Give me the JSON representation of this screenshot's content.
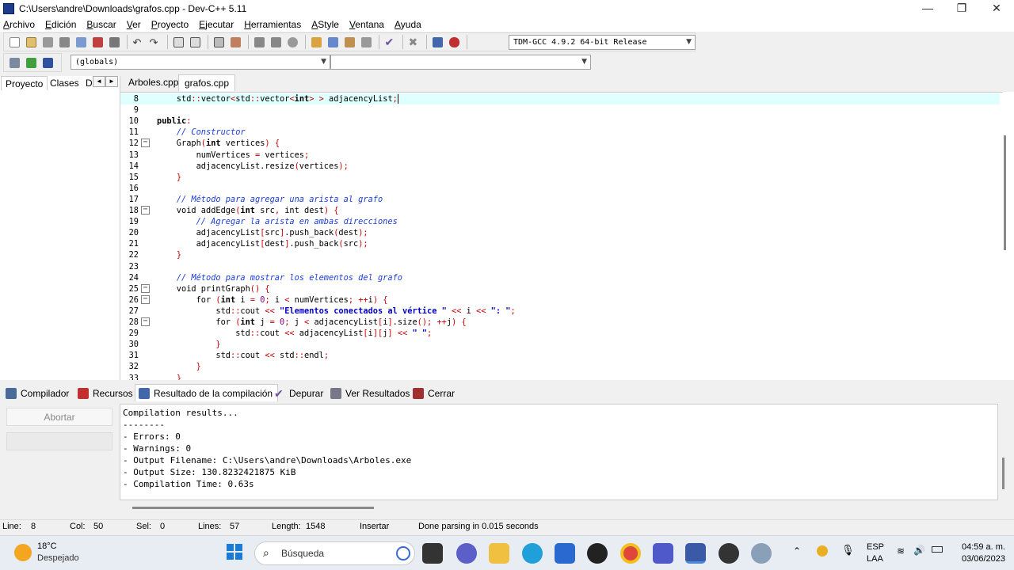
{
  "window": {
    "title": "C:\\Users\\andre\\Downloads\\grafos.cpp - Dev-C++ 5.11",
    "minimize": "—",
    "maximize": "❐",
    "close": "✕"
  },
  "menu": [
    "Archivo",
    "Edición",
    "Buscar",
    "Ver",
    "Proyecto",
    "Ejecutar",
    "Herramientas",
    "AStyle",
    "Ventana",
    "Ayuda"
  ],
  "toolbar": {
    "compiler_select": "TDM-GCC 4.9.2 64-bit Release",
    "scope_select": "(globals)",
    "member_select": ""
  },
  "panel_tabs": [
    "Proyecto",
    "Clases",
    "D"
  ],
  "file_tabs": [
    "Arboles.cpp",
    "grafos.cpp"
  ],
  "active_file_tab": "grafos.cpp",
  "editor": {
    "current_line": 8,
    "lines": [
      {
        "n": "8",
        "fold": "",
        "html": "    std::vector<std::vector<int> > adjacencyList;"
      },
      {
        "n": "9",
        "fold": "",
        "html": ""
      },
      {
        "n": "10",
        "fold": "",
        "html": "public:"
      },
      {
        "n": "11",
        "fold": "",
        "html": "    // Constructor"
      },
      {
        "n": "12",
        "fold": "−",
        "html": "    Graph(int vertices) {"
      },
      {
        "n": "13",
        "fold": "",
        "html": "        numVertices = vertices;"
      },
      {
        "n": "14",
        "fold": "",
        "html": "        adjacencyList.resize(vertices);"
      },
      {
        "n": "15",
        "fold": "",
        "html": "    }"
      },
      {
        "n": "16",
        "fold": "",
        "html": ""
      },
      {
        "n": "17",
        "fold": "",
        "html": "    // Método para agregar una arista al grafo"
      },
      {
        "n": "18",
        "fold": "−",
        "html": "    void addEdge(int src, int dest) {"
      },
      {
        "n": "19",
        "fold": "",
        "html": "        // Agregar la arista en ambas direcciones"
      },
      {
        "n": "20",
        "fold": "",
        "html": "        adjacencyList[src].push_back(dest);"
      },
      {
        "n": "21",
        "fold": "",
        "html": "        adjacencyList[dest].push_back(src);"
      },
      {
        "n": "22",
        "fold": "",
        "html": "    }"
      },
      {
        "n": "23",
        "fold": "",
        "html": ""
      },
      {
        "n": "24",
        "fold": "",
        "html": "    // Método para mostrar los elementos del grafo"
      },
      {
        "n": "25",
        "fold": "−",
        "html": "    void printGraph() {"
      },
      {
        "n": "26",
        "fold": "−",
        "html": "        for (int i = 0; i < numVertices; ++i) {"
      },
      {
        "n": "27",
        "fold": "",
        "html": "            std::cout << \"Elementos conectados al vértice \" << i << \": \";"
      },
      {
        "n": "28",
        "fold": "−",
        "html": "            for (int j = 0; j < adjacencyList[i].size(); ++j) {"
      },
      {
        "n": "29",
        "fold": "",
        "html": "                std::cout << adjacencyList[i][j] << \" \";"
      },
      {
        "n": "30",
        "fold": "",
        "html": "            }"
      },
      {
        "n": "31",
        "fold": "",
        "html": "            std::cout << std::endl;"
      },
      {
        "n": "32",
        "fold": "",
        "html": "        }"
      },
      {
        "n": "33",
        "fold": "",
        "html": "    }"
      }
    ]
  },
  "bottom_tabs": [
    "Compilador",
    "Recursos",
    "Resultado de la compilación",
    "Depurar",
    "Ver Resultados",
    "Cerrar"
  ],
  "active_bottom_tab": "Resultado de la compilación",
  "abort_button": "Abortar",
  "output_lines": [
    "Compilation results...",
    "--------",
    "- Errors: 0",
    "- Warnings: 0",
    "- Output Filename: C:\\Users\\andre\\Downloads\\Arboles.exe",
    "- Output Size: 130.8232421875 KiB",
    "- Compilation Time: 0.63s"
  ],
  "status": {
    "line_label": "Line:",
    "line_value": "8",
    "col_label": "Col:",
    "col_value": "50",
    "sel_label": "Sel:",
    "sel_value": "0",
    "lines_label": "Lines:",
    "lines_value": "57",
    "length_label": "Length:",
    "length_value": "1548",
    "mode": "Insertar",
    "message": "Done parsing in 0.015 seconds"
  },
  "taskbar": {
    "weather_temp": "18°C",
    "weather_desc": "Despejado",
    "search_placeholder": "Búsqueda",
    "lang_top": "ESP",
    "lang_bottom": "LAA",
    "time": "04:59 a. m.",
    "date": "03/06/2023"
  },
  "colors": {
    "current_line_bg": "#e0ffff",
    "comment": "#1a3dd9",
    "string": "#0000c0",
    "symbol": "#cc0000"
  }
}
